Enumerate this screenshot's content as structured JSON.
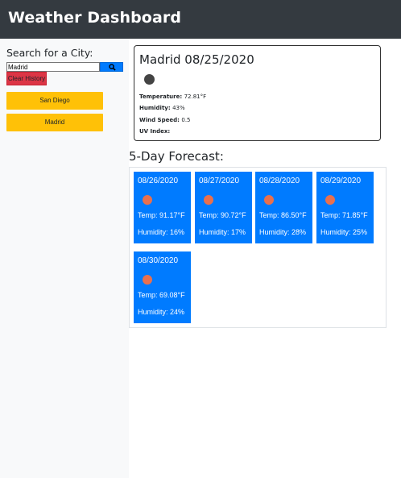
{
  "header": {
    "title": "Weather Dashboard"
  },
  "sidebar": {
    "search_label": "Search for a City:",
    "search_value": "Madrid",
    "search_button_icon": "search-icon",
    "clear_label": "Clear History",
    "history": [
      "San Diego",
      "Madrid"
    ]
  },
  "current": {
    "title": "Madrid 08/25/2020",
    "icon": "weather-icon",
    "temperature_label": "Temperature:",
    "temperature_value": "72.81°F",
    "humidity_label": "Humidity:",
    "humidity_value": "43%",
    "wind_label": "Wind Speed:",
    "wind_value": "0.5",
    "uv_label": "UV Index:",
    "uv_value": ""
  },
  "forecast": {
    "heading": "5-Day Forecast:",
    "days": [
      {
        "date": "08/26/2020",
        "temp": "Temp: 91.17°F",
        "humidity": "Humidity: 16%"
      },
      {
        "date": "08/27/2020",
        "temp": "Temp: 90.72°F",
        "humidity": "Humidity: 17%"
      },
      {
        "date": "08/28/2020",
        "temp": "Temp: 86.50°F",
        "humidity": "Humidity: 28%"
      },
      {
        "date": "08/29/2020",
        "temp": "Temp: 71.85°F",
        "humidity": "Humidity: 25%"
      },
      {
        "date": "08/30/2020",
        "temp": "Temp: 69.08°F",
        "humidity": "Humidity: 24%"
      }
    ]
  },
  "colors": {
    "navbar": "#343a40",
    "primary": "#007bff",
    "danger": "#dc3545",
    "warning": "#ffc107",
    "weather_icon": "#e8704e"
  }
}
